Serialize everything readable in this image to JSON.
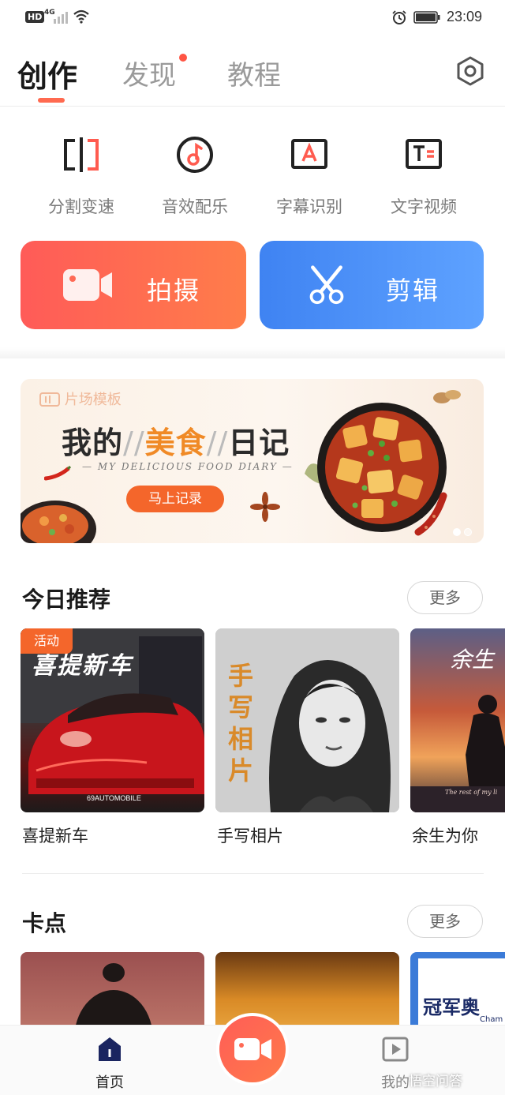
{
  "status_bar": {
    "hd": "HD",
    "network": "4G",
    "time": "23:09"
  },
  "tabs": [
    {
      "label": "创作",
      "active": true
    },
    {
      "label": "发现",
      "active": false,
      "has_dot": true
    },
    {
      "label": "教程",
      "active": false
    }
  ],
  "tools": [
    {
      "label": "分割变速",
      "icon": "split-speed-icon"
    },
    {
      "label": "音效配乐",
      "icon": "music-note-icon"
    },
    {
      "label": "字幕识别",
      "icon": "subtitle-recognition-icon"
    },
    {
      "label": "文字视频",
      "icon": "text-video-icon"
    }
  ],
  "actions": {
    "shoot_label": "拍摄",
    "edit_label": "剪辑"
  },
  "banner": {
    "tag": "片场模板",
    "title_part1": "我的",
    "title_highlight": "美食",
    "title_part2": "日记",
    "subtitle": "— MY DELICIOUS FOOD DIARY —",
    "cta": "马上记录",
    "page_count": 2,
    "active_page": 1
  },
  "today_section": {
    "title": "今日推荐",
    "more_label": "更多",
    "cards": [
      {
        "label": "喜提新车",
        "badge": "活动",
        "overlay_text": "喜提新车",
        "caption": "69AUTOMOBILE"
      },
      {
        "label": "手写相片",
        "overlay_text": "手写相片"
      },
      {
        "label": "余生为你",
        "overlay_text": "余生",
        "caption": "The rest of my li"
      }
    ]
  },
  "beat_section": {
    "title": "卡点",
    "more_label": "更多",
    "card3_text": "冠军奥",
    "card3_caption": "Cham"
  },
  "bottom_nav": {
    "home_label": "首页",
    "mine_label": "我的"
  },
  "watermark": "悟空问答",
  "colors": {
    "accent_orange": "#f4662b",
    "shoot_red": "#ff5b58",
    "edit_blue": "#3f83f2"
  }
}
